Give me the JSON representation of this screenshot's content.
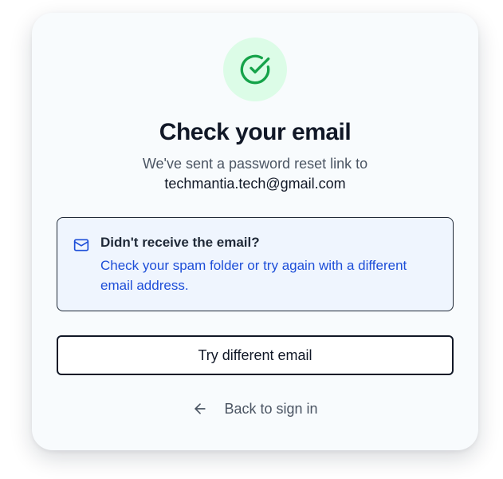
{
  "colors": {
    "success_bg": "#dcfce7",
    "success_icon": "#16a34a",
    "info_bg": "#eff5fe",
    "info_text": "#1d4ed8",
    "heading": "#111827",
    "muted": "#4b5563"
  },
  "header": {
    "icon": "check-circle-icon",
    "title": "Check your email",
    "subtitle": "We've sent a password reset link to",
    "email": "techmantia.tech@gmail.com"
  },
  "info": {
    "icon": "mail-icon",
    "heading": "Didn't receive the email?",
    "body": "Check your spam folder or try again with a different email address."
  },
  "actions": {
    "try_different_label": "Try different email",
    "back_icon": "arrow-left-icon",
    "back_label": "Back to sign in"
  }
}
